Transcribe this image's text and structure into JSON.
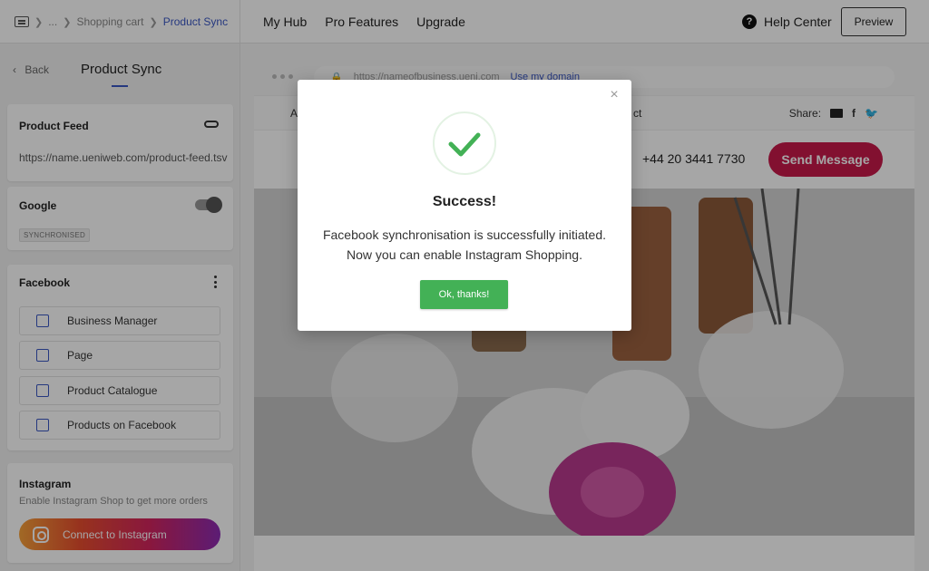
{
  "breadcrumb": {
    "ellipsis": "...",
    "parent": "Shopping cart",
    "current": "Product Sync"
  },
  "topnav": {
    "items": [
      "My Hub",
      "Pro Features",
      "Upgrade"
    ],
    "help": "Help Center",
    "preview": "Preview"
  },
  "sidebar": {
    "back": "Back",
    "title": "Product Sync",
    "product_feed": {
      "title": "Product Feed",
      "url": "https://name.ueniweb.com/product-feed.tsv"
    },
    "google": {
      "title": "Google",
      "badge": "SYNCHRONISED",
      "enabled": true
    },
    "facebook": {
      "title": "Facebook",
      "items": [
        {
          "label": "Business Manager",
          "icon": "building-icon"
        },
        {
          "label": "Page",
          "icon": "document-icon"
        },
        {
          "label": "Product Catalogue",
          "icon": "catalogue-icon"
        },
        {
          "label": "Products on Facebook",
          "icon": "shopping-bag-icon"
        }
      ]
    },
    "instagram": {
      "title": "Instagram",
      "subtitle": "Enable Instagram Shop to get more orders",
      "button": "Connect to Instagram"
    }
  },
  "site_preview": {
    "url": "https://nameofbusiness.ueni.com",
    "use_domain": "Use my domain",
    "nav_left": "A",
    "nav_right_partial": "ct",
    "share_label": "Share:",
    "phone": "+44 20 3441 7730",
    "send_button": "Send Message"
  },
  "modal": {
    "title": "Success!",
    "message_line1": "Facebook synchronisation is successfully initiated.",
    "message_line2": "Now you can enable Instagram Shopping.",
    "button": "Ok, thanks!",
    "close": "×"
  },
  "colors": {
    "accent": "#3a57c4",
    "success": "#43b156",
    "send": "#c8194a"
  }
}
